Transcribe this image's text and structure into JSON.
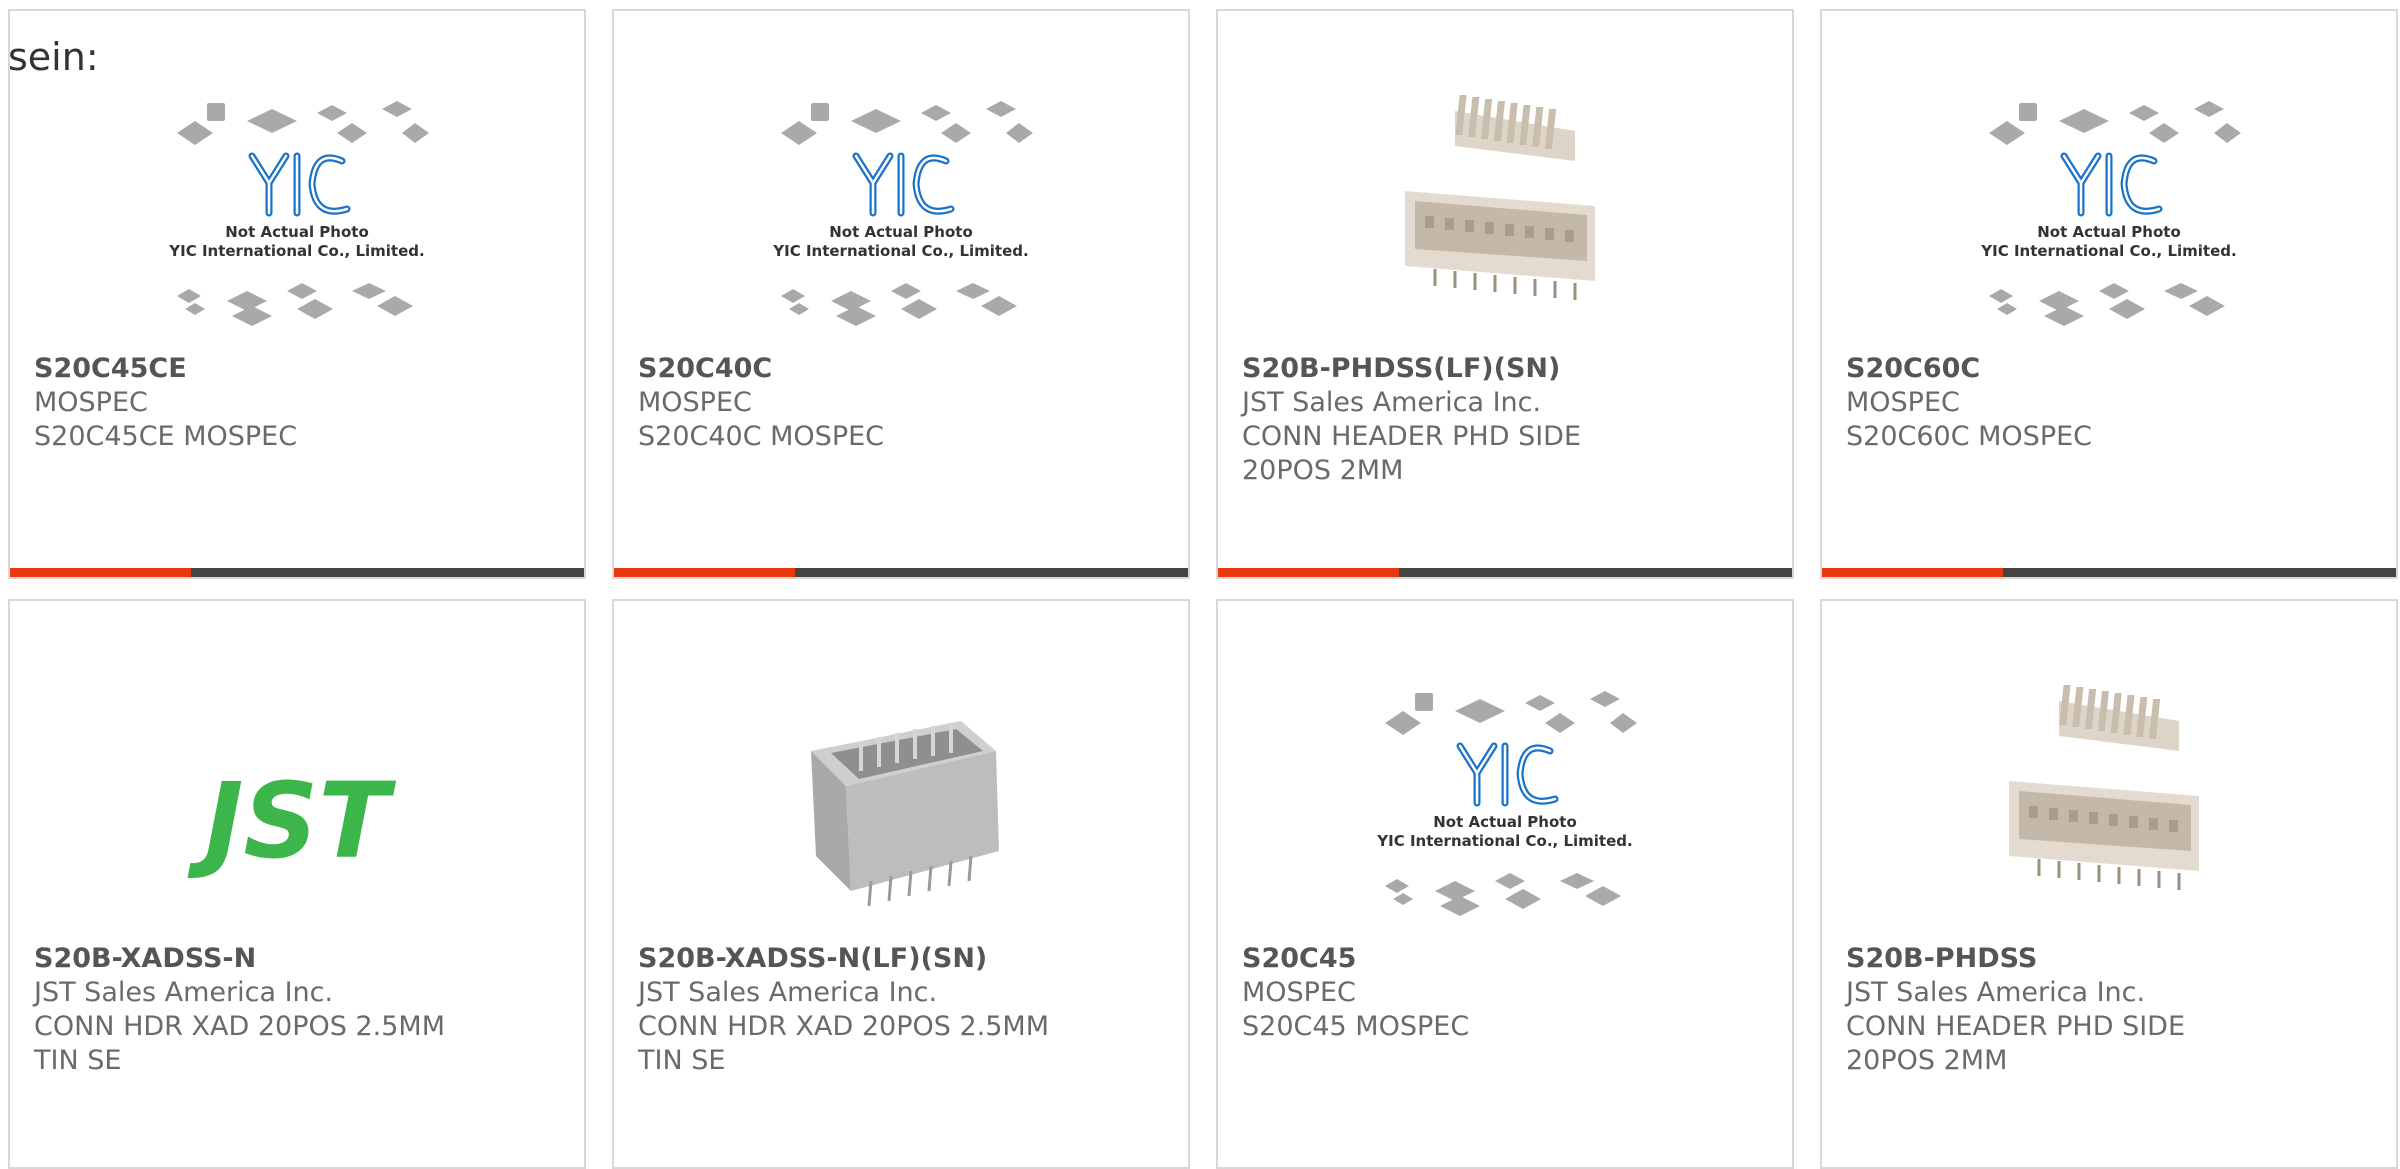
{
  "intro_text": "sein:",
  "colors": {
    "accent_bar": "#e8380d",
    "dark_bar": "#444444",
    "jst_green": "#3cb54a",
    "yic_blue": "#1a73c8"
  },
  "cards": [
    {
      "part": "S20C45CE",
      "manufacturer": "MOSPEC",
      "description": "S20C45CE MOSPEC",
      "image": "yic-placeholder",
      "placeholder_line1": "Not Actual Photo",
      "placeholder_line2": "YIC International Co., Limited."
    },
    {
      "part": "S20C40C",
      "manufacturer": "MOSPEC",
      "description": "S20C40C MOSPEC",
      "image": "yic-placeholder",
      "placeholder_line1": "Not Actual Photo",
      "placeholder_line2": "YIC International Co., Limited."
    },
    {
      "part": "S20B-PHDSS(LF)(SN)",
      "manufacturer": "JST Sales America Inc.",
      "description": "CONN HEADER PHD SIDE 20POS 2MM",
      "image": "phd-header-photo"
    },
    {
      "part": "S20C60C",
      "manufacturer": "MOSPEC",
      "description": "S20C60C MOSPEC",
      "image": "yic-placeholder",
      "placeholder_line1": "Not Actual Photo",
      "placeholder_line2": "YIC International Co., Limited."
    },
    {
      "part": "S20B-XADSS-N",
      "manufacturer": "JST Sales America Inc.",
      "description": "CONN HDR XAD 20POS 2.5MM TIN SE",
      "image": "jst-logo",
      "logo_text": "JST"
    },
    {
      "part": "S20B-XADSS-N(LF)(SN)",
      "manufacturer": "JST Sales America Inc.",
      "description": "CONN HDR XAD 20POS 2.5MM TIN SE",
      "image": "xad-header-photo"
    },
    {
      "part": "S20C45",
      "manufacturer": "MOSPEC",
      "description": "S20C45 MOSPEC",
      "image": "yic-placeholder",
      "placeholder_line1": "Not Actual Photo",
      "placeholder_line2": "YIC International Co., Limited."
    },
    {
      "part": "S20B-PHDSS",
      "manufacturer": "JST Sales America Inc.",
      "description": "CONN HEADER PHD SIDE 20POS 2MM",
      "image": "phd-header-photo"
    }
  ]
}
